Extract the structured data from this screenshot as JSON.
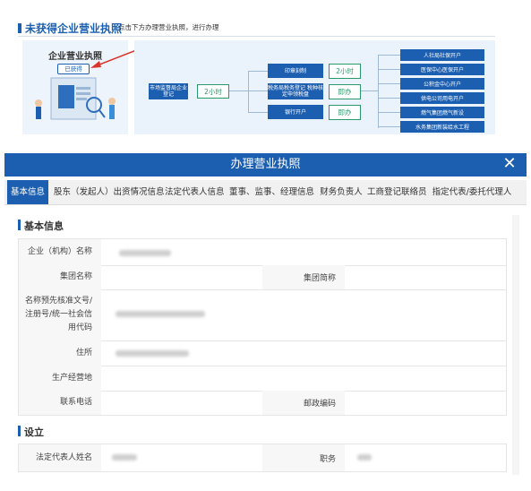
{
  "banner": {
    "title": "未获得企业营业执照",
    "hint": "点击下方办理营业执照，进行办理",
    "license_title": "企业营业执照",
    "license_badge": "已获得",
    "flow": {
      "start_label": "市场监督局企业登记",
      "start_time": "2小时",
      "mid": [
        {
          "label": "印章刻制",
          "status": "2小时"
        },
        {
          "label": "税务局税务登记 税种核定申领税盘",
          "status": "即办"
        },
        {
          "label": "银行开户",
          "status": "即办"
        }
      ],
      "right": [
        "人社局社保开户",
        "医保中心医保开户",
        "公积金中心开户",
        "供电公司用电开户",
        "燃气集团燃气新设",
        "水务集团新装给水工程"
      ]
    }
  },
  "dialog": {
    "title": "办理营业执照",
    "close_label": "✕",
    "tabs": [
      "基本信息",
      "股东（发起人）出资情况信息",
      "法定代表人信息",
      "董事、监事、经理信息",
      "财务负责人",
      "工商登记联络员",
      "指定代表/委托代理人"
    ],
    "active_tab": "基本信息",
    "section_basic": "基本信息",
    "fields": {
      "company_name": "企业（机构）名称",
      "group_name": "集团名称",
      "group_short": "集团简称",
      "prenote": "名称预先核准文号/注册号/统一社会信用代码",
      "address": "住所",
      "prod_place": "生产经营地",
      "phone": "联系电话",
      "postcode": "邮政编码"
    },
    "section_setup": "设立",
    "setup_fields": {
      "legal_rep": "法定代表人姓名",
      "position": "职务"
    }
  },
  "colors": {
    "brand": "#1c5fb0",
    "success": "#2a9a6a"
  }
}
